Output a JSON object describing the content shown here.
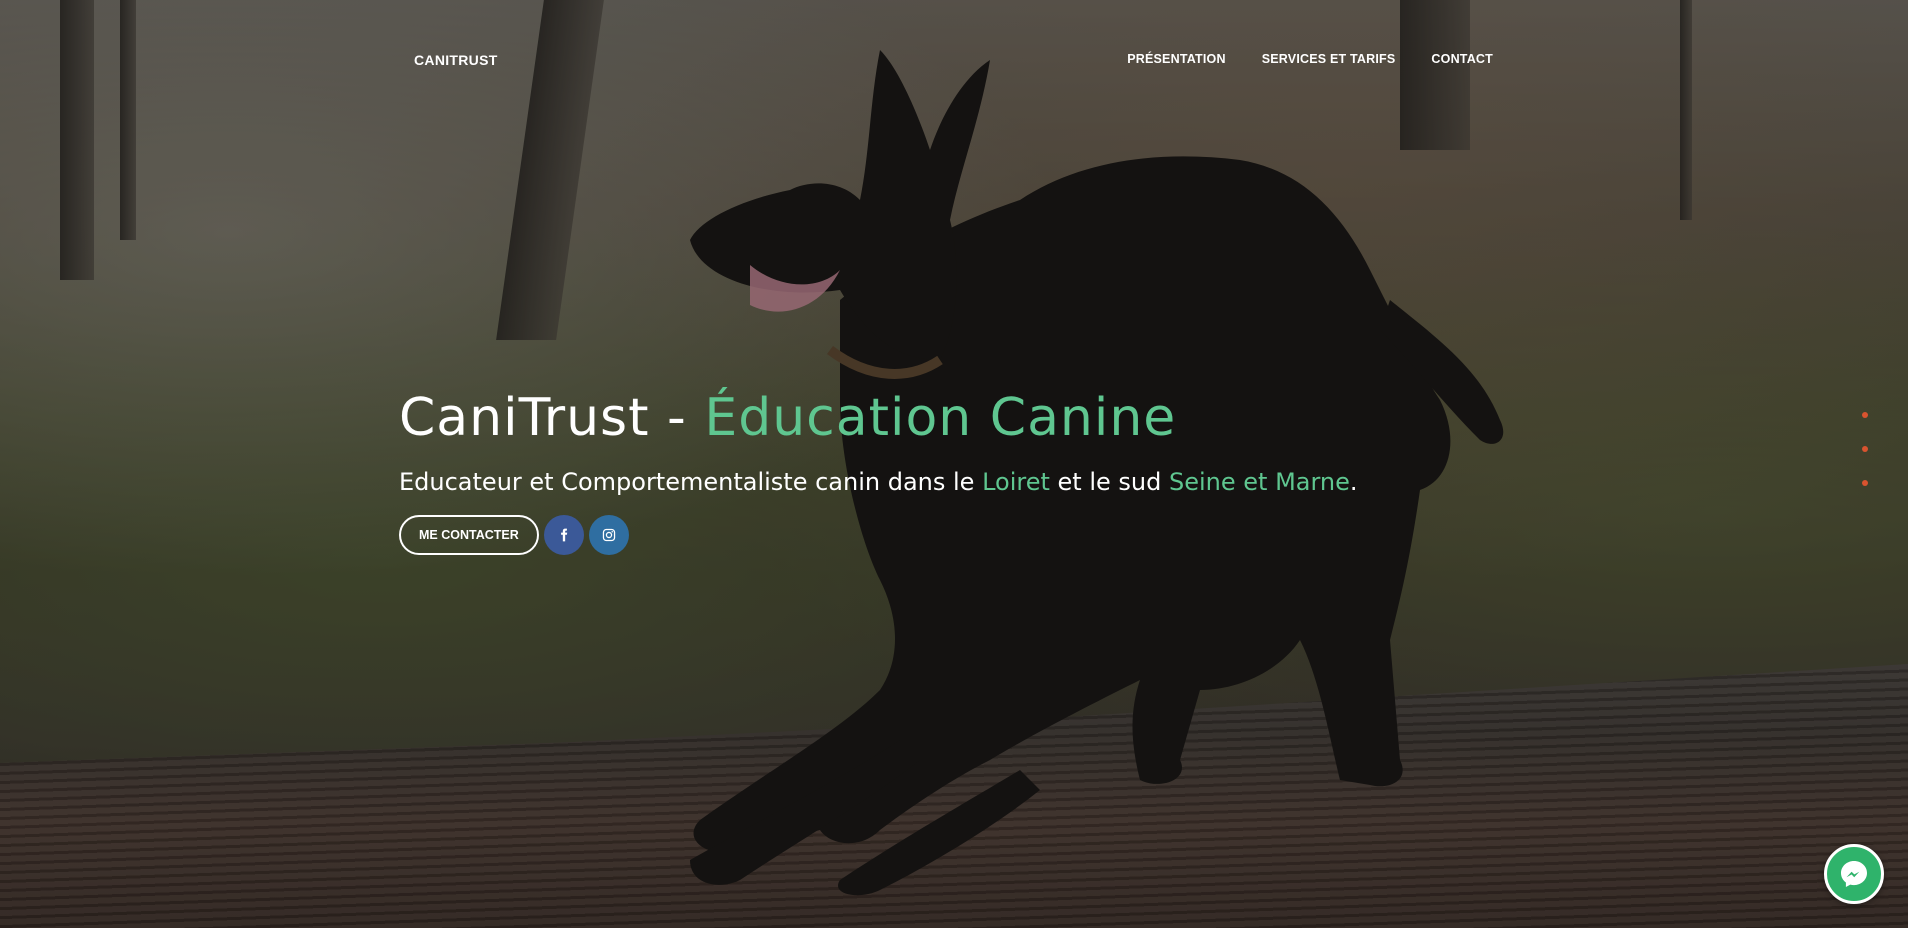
{
  "brand": {
    "name": "CANITRUST"
  },
  "nav": {
    "items": [
      {
        "label": "PRÉSENTATION"
      },
      {
        "label": "SERVICES ET TARIFS"
      },
      {
        "label": "CONTACT"
      }
    ]
  },
  "hero": {
    "title_main": "CaniTrust - ",
    "title_accent": "Éducation Canine",
    "subtitle_part1": "Educateur et Comportementaliste canin dans le ",
    "subtitle_accent1": "Loiret",
    "subtitle_part2": " et le sud ",
    "subtitle_accent2": "Seine et Marne",
    "subtitle_end": ".",
    "contact_button": "ME CONTACTER",
    "social": [
      {
        "icon": "facebook-icon"
      },
      {
        "icon": "instagram-icon"
      }
    ]
  },
  "side_nav": {
    "dots": 3
  },
  "colors": {
    "accent": "#5fc690",
    "facebook": "#3b5998",
    "instagram": "#2f6ea1",
    "dot": "#d9532f",
    "messenger": "#2fb36b"
  },
  "chat_widget": {
    "icon": "messenger-icon"
  }
}
